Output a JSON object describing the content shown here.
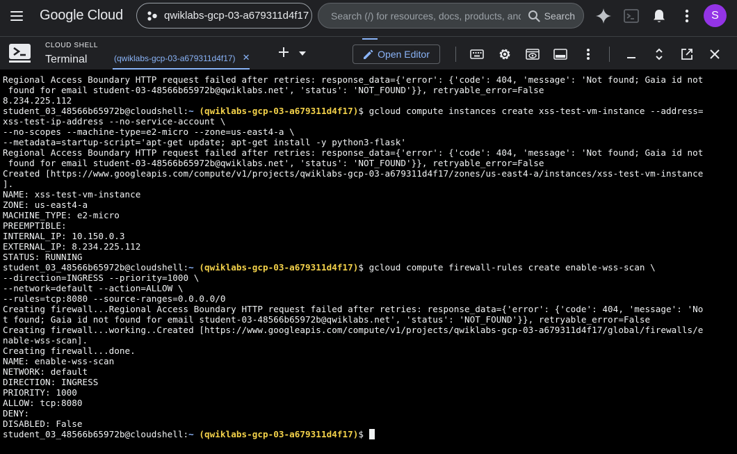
{
  "topbar": {
    "logo_text": "Google Cloud",
    "project_name": "qwiklabs-gcp-03-a679311d4f17",
    "search_placeholder": "Search (/) for resources, docs, products, and more",
    "search_button_label": "Search",
    "avatar_letter": "S"
  },
  "shell": {
    "caption": "CLOUD SHELL",
    "title": "Terminal",
    "tab_label": "(qwiklabs-gcp-03-a679311d4f17)",
    "open_editor_label": "Open Editor"
  },
  "prompt": {
    "user": "student_03_48566b65972b@cloudshell:",
    "path": "~",
    "project": "(qwiklabs-gcp-03-a679311d4f17)",
    "symbol": "$"
  },
  "terminal_lines": [
    {
      "text": "Regional Access Boundary HTTP request failed after retries: response_data={'error': {'code': 404, 'message': 'Not found; Gaia id not"
    },
    {
      "text": " found for email student-03-48566b65972b@qwiklabs.net', 'status': 'NOT_FOUND'}}, retryable_error=False"
    },
    {
      "text": "8.234.225.112"
    },
    {
      "prompt": true,
      "command": "gcloud compute instances create xss-test-vm-instance --address="
    },
    {
      "text": "xss-test-ip-address --no-service-account \\"
    },
    {
      "text": "--no-scopes --machine-type=e2-micro --zone=us-east4-a \\"
    },
    {
      "text": "--metadata=startup-script='apt-get update; apt-get install -y python3-flask'"
    },
    {
      "text": "Regional Access Boundary HTTP request failed after retries: response_data={'error': {'code': 404, 'message': 'Not found; Gaia id not"
    },
    {
      "text": " found for email student-03-48566b65972b@qwiklabs.net', 'status': 'NOT_FOUND'}}, retryable_error=False"
    },
    {
      "text": "Created [https://www.googleapis.com/compute/v1/projects/qwiklabs-gcp-03-a679311d4f17/zones/us-east4-a/instances/xss-test-vm-instance"
    },
    {
      "text": "]."
    },
    {
      "text": "NAME: xss-test-vm-instance"
    },
    {
      "text": "ZONE: us-east4-a"
    },
    {
      "text": "MACHINE_TYPE: e2-micro"
    },
    {
      "text": "PREEMPTIBLE:"
    },
    {
      "text": "INTERNAL_IP: 10.150.0.3"
    },
    {
      "text": "EXTERNAL_IP: 8.234.225.112"
    },
    {
      "text": "STATUS: RUNNING"
    },
    {
      "prompt": true,
      "command": "gcloud compute firewall-rules create enable-wss-scan \\"
    },
    {
      "text": "--direction=INGRESS --priority=1000 \\"
    },
    {
      "text": "--network=default --action=ALLOW \\"
    },
    {
      "text": "--rules=tcp:8080 --source-ranges=0.0.0.0/0"
    },
    {
      "text": "Creating firewall...Regional Access Boundary HTTP request failed after retries: response_data={'error': {'code': 404, 'message': 'No"
    },
    {
      "text": "t found; Gaia id not found for email student-03-48566b65972b@qwiklabs.net', 'status': 'NOT_FOUND'}}, retryable_error=False"
    },
    {
      "text": "Creating firewall...working..Created [https://www.googleapis.com/compute/v1/projects/qwiklabs-gcp-03-a679311d4f17/global/firewalls/e"
    },
    {
      "text": "nable-wss-scan]."
    },
    {
      "text": "Creating firewall...done."
    },
    {
      "text": "NAME: enable-wss-scan"
    },
    {
      "text": "NETWORK: default"
    },
    {
      "text": "DIRECTION: INGRESS"
    },
    {
      "text": "PRIORITY: 1000"
    },
    {
      "text": "ALLOW: tcp:8080"
    },
    {
      "text": "DENY:"
    },
    {
      "text": "DISABLED: False"
    },
    {
      "prompt": true,
      "command": "",
      "cursor": true
    }
  ],
  "colors": {
    "background": "#202124",
    "terminal_background": "#000000",
    "accent": "#8ab4f8",
    "prompt_project": "#f4d24a",
    "avatar": "#9334e6"
  },
  "icons": {
    "menu": "hamburger-menu-icon",
    "project": "project-picker-icon",
    "search": "search-icon",
    "gemini": "gemini-sparkle-icon",
    "shell": "cloud-shell-icon",
    "notifications": "bell-icon",
    "more": "more-vert-icon",
    "keyboard": "keyboard-icon",
    "settings": "gear-icon",
    "web_preview": "web-preview-icon",
    "panel": "panel-layout-icon",
    "minimize": "minimize-icon",
    "expand": "expand-icon",
    "open_new_window": "open-in-new-icon",
    "close": "close-icon",
    "edit": "pencil-icon"
  }
}
